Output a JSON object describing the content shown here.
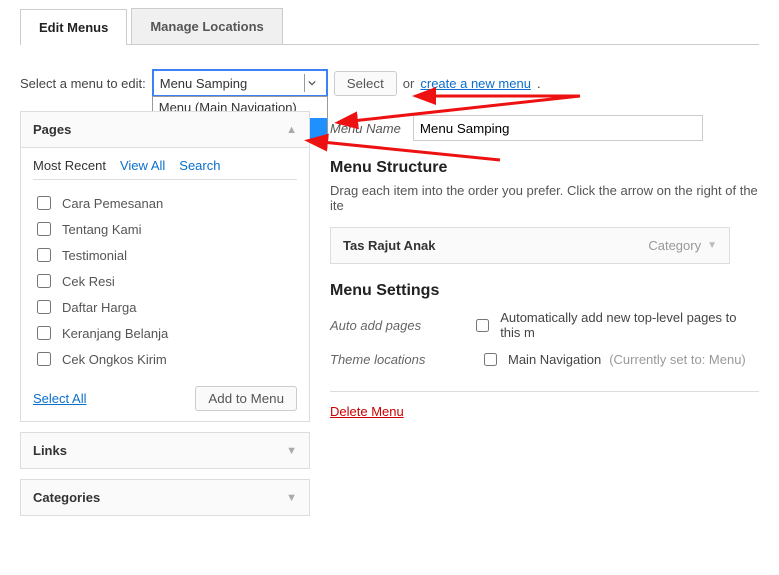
{
  "tabs": {
    "edit": "Edit Menus",
    "manage": "Manage Locations"
  },
  "selectRow": {
    "label": "Select a menu to edit:",
    "current": "Menu Samping",
    "options": [
      "Menu (Main Navigation)",
      "Menu Samping"
    ],
    "selectBtn": "Select",
    "or": "or",
    "createLink": "create a new menu"
  },
  "sidebar": {
    "pages": {
      "title": "Pages",
      "subtabs": {
        "recent": "Most Recent",
        "viewAll": "View All",
        "search": "Search"
      },
      "items": [
        "Cara Pemesanan",
        "Tentang Kami",
        "Testimonial",
        "Cek Resi",
        "Daftar Harga",
        "Keranjang Belanja",
        "Cek Ongkos Kirim"
      ],
      "selectAll": "Select All",
      "addBtn": "Add to Menu"
    },
    "links": {
      "title": "Links"
    },
    "categories": {
      "title": "Categories"
    }
  },
  "main": {
    "menuNameLabel": "Menu Name",
    "menuNameValue": "Menu Samping",
    "structure": {
      "title": "Menu Structure",
      "desc": "Drag each item into the order you prefer. Click the arrow on the right of the ite",
      "item": {
        "label": "Tas Rajut Anak",
        "type": "Category"
      }
    },
    "settings": {
      "title": "Menu Settings",
      "autoLabel": "Auto add pages",
      "autoText": "Automatically add new top-level pages to this m",
      "themeLabel": "Theme locations",
      "themeText": "Main Navigation",
      "themeHint": "(Currently set to: Menu)"
    },
    "delete": "Delete Menu"
  }
}
